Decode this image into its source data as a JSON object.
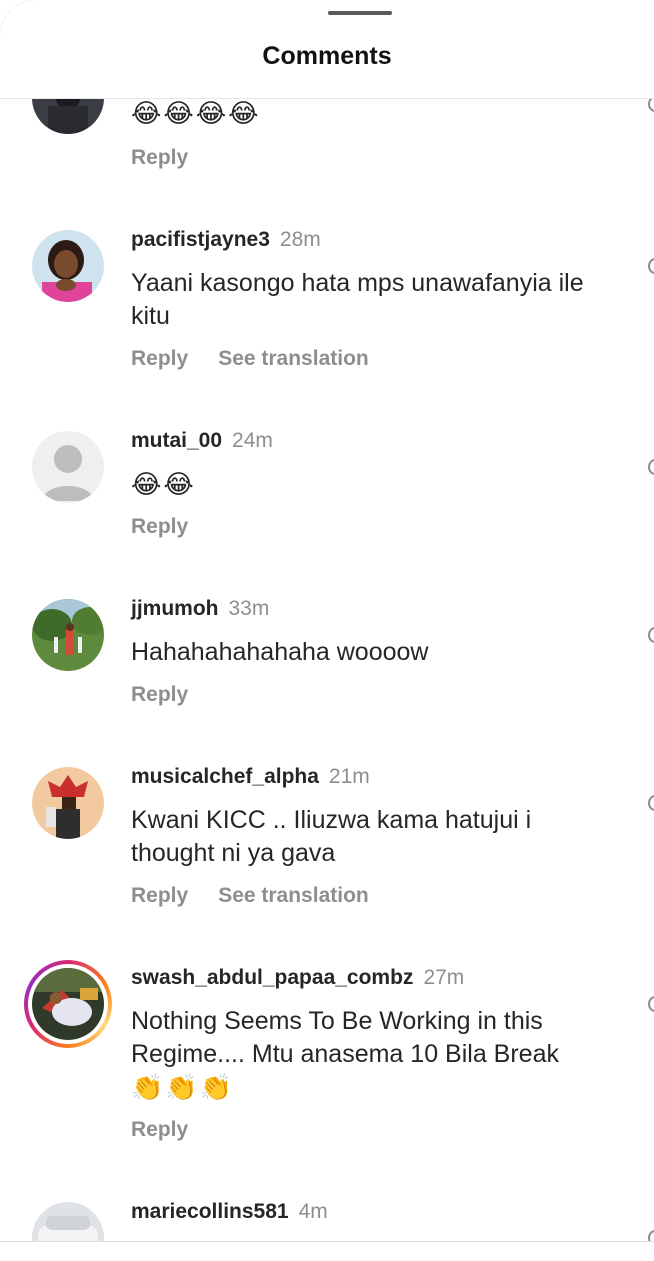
{
  "header": {
    "title": "Comments"
  },
  "comments": [
    {
      "username": "",
      "time": "",
      "text": "😂😂😂😂",
      "reply": "Reply",
      "see_translation": "",
      "avatar": "user-photo"
    },
    {
      "username": "pacifistjayne3",
      "time": "28m",
      "text": "Yaani kasongo hata mps unawafanyia ile kitu",
      "reply": "Reply",
      "see_translation": "See translation",
      "avatar": "woman-photo"
    },
    {
      "username": "mutai_00",
      "time": "24m",
      "text": "😂😂",
      "reply": "Reply",
      "see_translation": "",
      "avatar": "default-avatar"
    },
    {
      "username": "jjmumoh",
      "time": "33m",
      "text": "Hahahahahahaha woooow",
      "reply": "Reply",
      "see_translation": "",
      "avatar": "garden-photo"
    },
    {
      "username": "musicalchef_alpha",
      "time": "21m",
      "text": "Kwani KICC .. Iliuzwa kama hatujui i thought ni ya gava",
      "reply": "Reply",
      "see_translation": "See translation",
      "avatar": "king-photo"
    },
    {
      "username": "swash_abdul_papaa_combz",
      "time": "27m",
      "text": "Nothing Seems To Be Working in this Regime.... Mtu anasema 10 Bila Break",
      "text_emoji": "👏👏👏",
      "reply": "Reply",
      "see_translation": "",
      "avatar": "story-photo"
    },
    {
      "username": "mariecollins581",
      "time": "4m",
      "text": "",
      "reply": "",
      "see_translation": "",
      "avatar": "car-photo"
    }
  ],
  "colors": {
    "username": "#262626",
    "meta_gray": "#8e8e8e",
    "story_ring": [
      "#d62976",
      "#fa7e1e",
      "#feda75",
      "#962fbf"
    ]
  }
}
